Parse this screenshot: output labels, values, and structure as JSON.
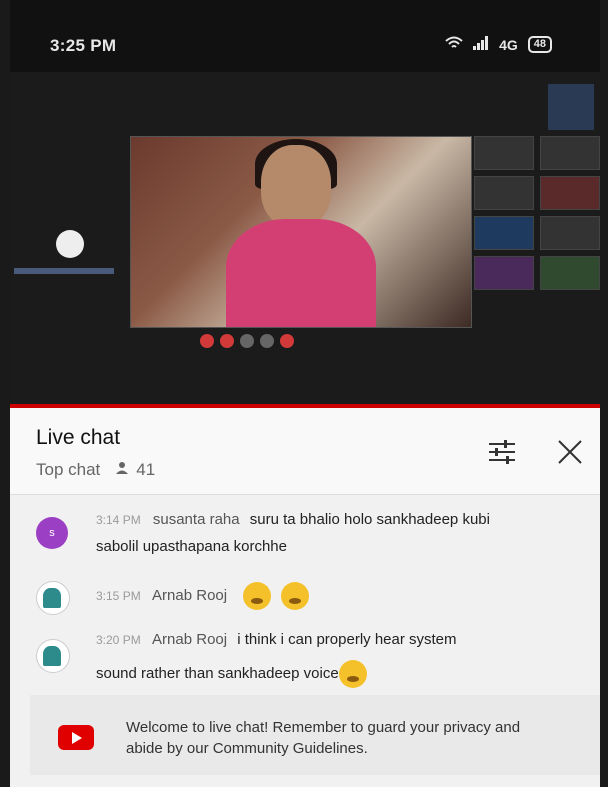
{
  "status_bar": {
    "time": "3:25 PM",
    "network": "4G",
    "battery": "48"
  },
  "chat": {
    "title": "Live chat",
    "mode": "Top chat",
    "viewer_count": "41",
    "filter_icon": "tune-icon",
    "close_icon": "close-icon"
  },
  "messages": [
    {
      "time": "3:14 PM",
      "author": "susanta raha",
      "text": "suru ta bhalio holo sankhadeep kubi",
      "text_line2": "sabolil upasthapana korchhe",
      "avatar_initial": "s"
    },
    {
      "time": "3:15 PM",
      "author": "Arnab Rooj",
      "text": "",
      "emoji": "emoji-face"
    },
    {
      "time": "3:20 PM",
      "author": "Arnab Rooj",
      "text": "i think i can properly hear system",
      "text_line2": "sound rather than sankhadeep voice"
    }
  ],
  "welcome": {
    "text": "Welcome to live chat! Remember to guard your privacy and abide by our Community Guidelines."
  },
  "colors": {
    "accent_red": "#cc0000",
    "youtube_red": "#e00000",
    "avatar_purple": "#9b3fc4"
  }
}
